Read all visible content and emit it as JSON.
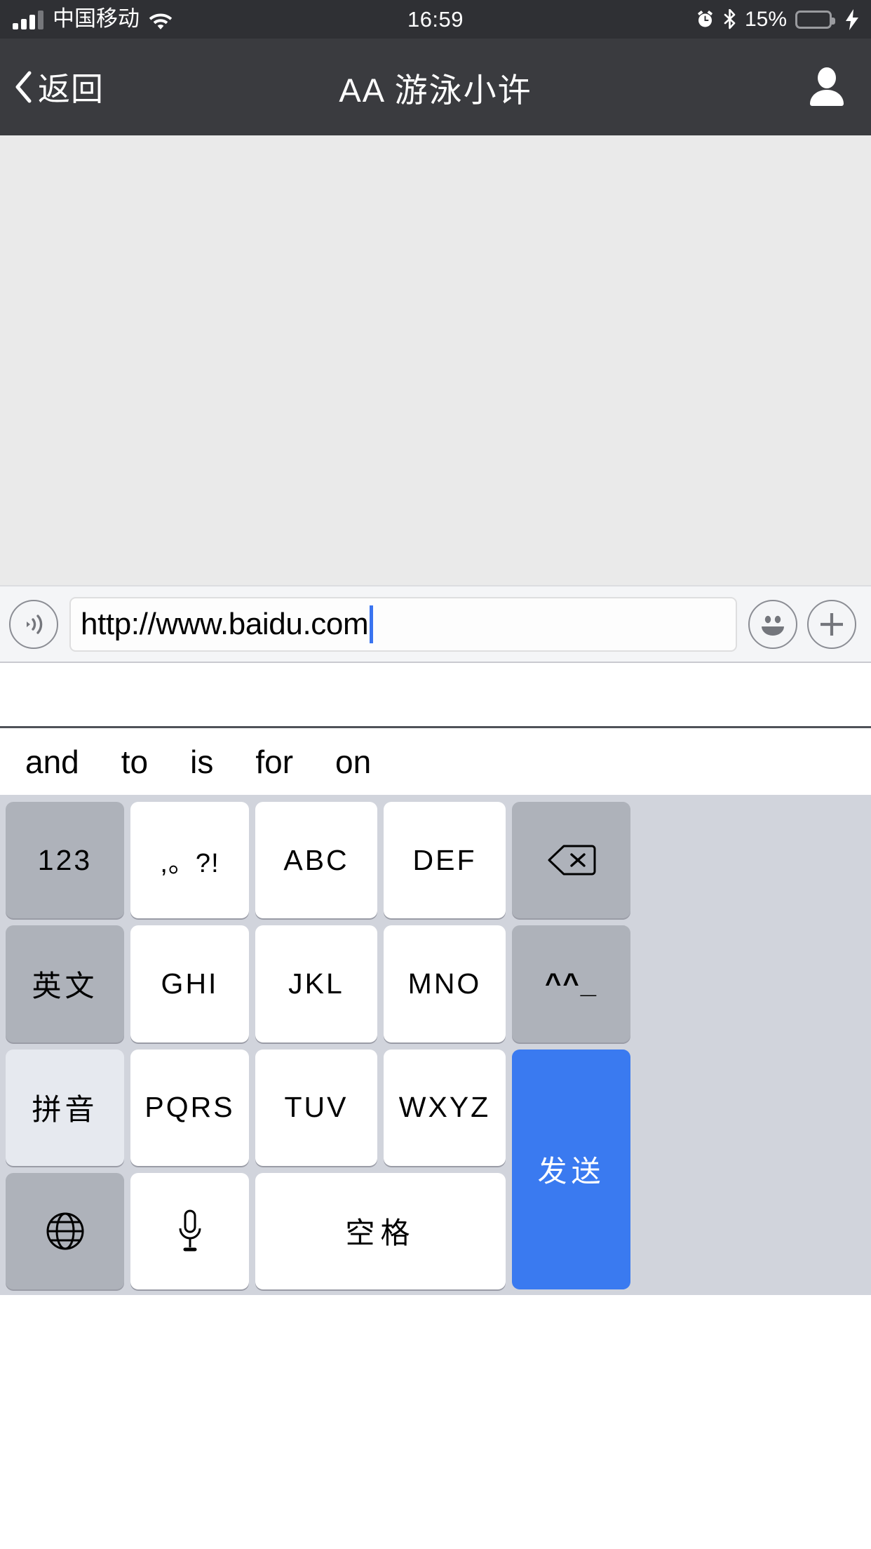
{
  "status_bar": {
    "carrier": "中国移动",
    "time": "16:59",
    "battery_percent": "15%",
    "battery_level": 15,
    "icons": [
      "signal-bars",
      "wifi-icon",
      "alarm-icon",
      "bluetooth-icon",
      "battery-icon",
      "charging-bolt-icon"
    ],
    "colors": {
      "background": "#2f3034",
      "battery_fill": "#f1492f",
      "text": "#ffffff"
    }
  },
  "nav_bar": {
    "back_label": "返回",
    "title": "AA 游泳小许",
    "avatar_icon": "person-icon",
    "background": "#3a3b3f"
  },
  "chat": {
    "background": "#eaeaea",
    "messages": []
  },
  "input_bar": {
    "voice_icon": "voice-wave-icon",
    "value": "http://www.baidu.com",
    "placeholder": "",
    "emoji_icon": "smiley-icon",
    "plus_icon": "plus-icon",
    "caret_color": "#3a74f0"
  },
  "suggestions": {
    "items": [
      "and",
      "to",
      "is",
      "for",
      "on"
    ]
  },
  "keyboard": {
    "background": "#d1d4dc",
    "send_color": "#3a7af0",
    "rows": [
      [
        {
          "label": "123",
          "style": "gray",
          "name": "key-123"
        },
        {
          "label": ",。?!",
          "style": "white",
          "name": "key-punctuation"
        },
        {
          "label": "ABC",
          "style": "white",
          "name": "key-abc"
        },
        {
          "label": "DEF",
          "style": "white",
          "name": "key-def"
        },
        {
          "label": "",
          "style": "gray",
          "name": "key-backspace",
          "icon": "backspace-icon"
        }
      ],
      [
        {
          "label": "英文",
          "style": "gray",
          "name": "key-english"
        },
        {
          "label": "GHI",
          "style": "white",
          "name": "key-ghi"
        },
        {
          "label": "JKL",
          "style": "white",
          "name": "key-jkl"
        },
        {
          "label": "MNO",
          "style": "white",
          "name": "key-mno"
        },
        {
          "label": "^^_",
          "style": "gray",
          "name": "key-emoticon"
        }
      ],
      [
        {
          "label": "拼音",
          "style": "light",
          "name": "key-pinyin"
        },
        {
          "label": "PQRS",
          "style": "white",
          "name": "key-pqrs"
        },
        {
          "label": "TUV",
          "style": "white",
          "name": "key-tuv"
        },
        {
          "label": "WXYZ",
          "style": "white",
          "name": "key-wxyz"
        },
        {
          "label": "发送",
          "style": "blue",
          "name": "key-send"
        }
      ],
      [
        {
          "label": "",
          "style": "gray",
          "name": "key-globe",
          "icon": "globe-icon"
        },
        {
          "label": "",
          "style": "white",
          "name": "key-microphone",
          "icon": "microphone-icon"
        },
        {
          "label": "空格",
          "style": "white",
          "name": "key-space"
        }
      ]
    ]
  }
}
